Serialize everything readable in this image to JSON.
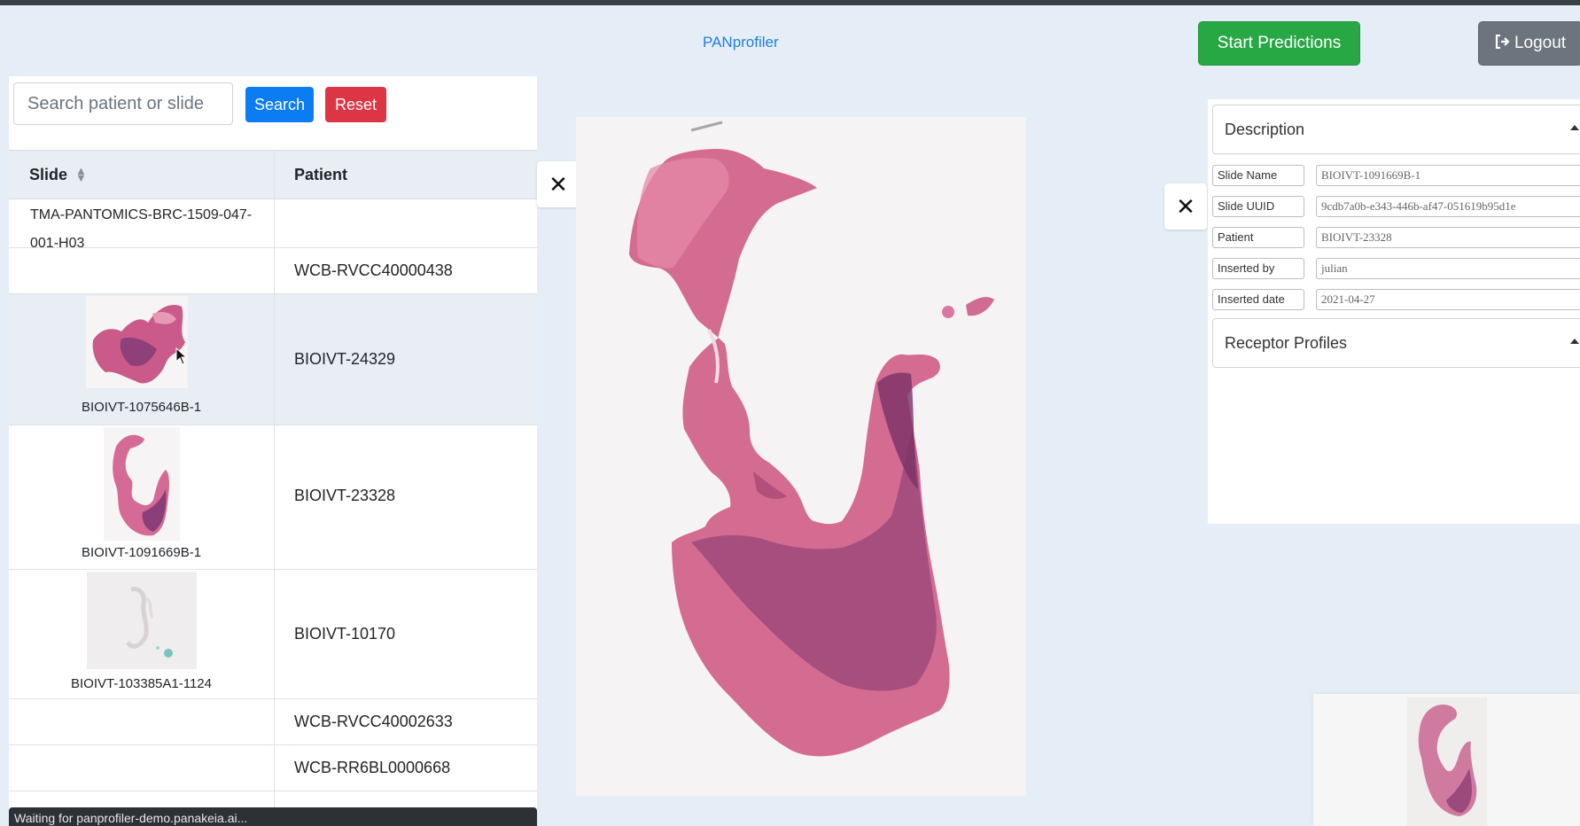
{
  "app": {
    "brand": "PANprofiler",
    "start_predictions_label": "Start Predictions",
    "logout_label": "Logout"
  },
  "search": {
    "placeholder": "Search patient or slide",
    "search_label": "Search",
    "reset_label": "Reset"
  },
  "table": {
    "headers": {
      "slide": "Slide",
      "patient": "Patient"
    },
    "rows": [
      {
        "slide": "TMA-PANTOMICS-BRC-1509-047-001-H03",
        "patient": ""
      },
      {
        "slide": "",
        "patient": "WCB-RVCC40000438"
      },
      {
        "slide": "BIOIVT-1075646B-1",
        "patient": "BIOIVT-24329"
      },
      {
        "slide": "BIOIVT-1091669B-1",
        "patient": "BIOIVT-23328"
      },
      {
        "slide": "BIOIVT-103385A1-1124",
        "patient": "BIOIVT-10170"
      },
      {
        "slide": "",
        "patient": "WCB-RVCC40002633"
      },
      {
        "slide": "",
        "patient": "WCB-RR6BL0000668"
      }
    ]
  },
  "status": "Waiting for panprofiler-demo.panakeia.ai...",
  "details": {
    "description_title": "Description",
    "receptor_title": "Receptor Profiles",
    "fields": [
      {
        "label": "Slide Name",
        "value": "BIOIVT-1091669B-1"
      },
      {
        "label": "Slide UUID",
        "value": "9cdb7a0b-e343-446b-af47-051619b95d1e"
      },
      {
        "label": "Patient",
        "value": "BIOIVT-23328"
      },
      {
        "label": "Inserted by",
        "value": "julian"
      },
      {
        "label": "Inserted date",
        "value": "2021-04-27"
      }
    ]
  },
  "colors": {
    "start_button": "#28a745",
    "logout_button": "#6c757d",
    "search_button": "#0b7cf1",
    "reset_button": "#dc3545",
    "brand": "#1d7fd6"
  }
}
